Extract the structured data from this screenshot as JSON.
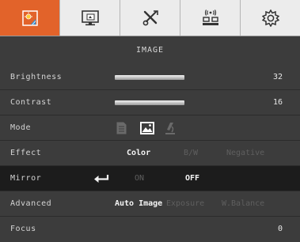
{
  "tabs": [
    {
      "icon": "image-settings-icon",
      "active": true
    },
    {
      "icon": "display-screen-icon",
      "active": false
    },
    {
      "icon": "tools-icon",
      "active": false
    },
    {
      "icon": "network-icon",
      "active": false
    },
    {
      "icon": "system-gear-icon",
      "active": false
    }
  ],
  "section_title": "IMAGE",
  "rows": {
    "brightness": {
      "label": "Brightness",
      "value": "32",
      "level": 32
    },
    "contrast": {
      "label": "Contrast",
      "value": "16",
      "level": 16
    },
    "mode": {
      "label": "Mode",
      "options": [
        "document-icon",
        "photo-icon",
        "microscope-icon"
      ],
      "selected": "photo-icon"
    },
    "effect": {
      "label": "Effect",
      "options": [
        "Color",
        "B/W",
        "Negative"
      ],
      "selected": "Color"
    },
    "mirror": {
      "label": "Mirror",
      "options": [
        "ON",
        "OFF"
      ],
      "selected": "OFF",
      "enter_icon": "enter-arrow-icon"
    },
    "advanced": {
      "label": "Advanced",
      "options": [
        "Auto Image",
        "Exposure",
        "W.Balance"
      ],
      "selected": "Auto Image"
    },
    "focus": {
      "label": "Focus",
      "value": "0"
    }
  },
  "colors": {
    "active_tab": "#e2632a",
    "background": "#3c3c3c",
    "highlight_row": "#1c1c1c",
    "tab_bar": "#ececec"
  }
}
